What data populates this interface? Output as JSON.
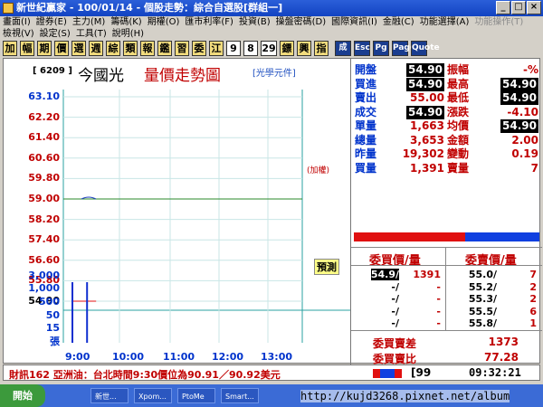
{
  "window": {
    "title": "新世紀贏家 - 100/01/14 - 個股走勢：綜合自選股[群組一]",
    "minimize": "_",
    "maximize": "□",
    "close": "×"
  },
  "menu_row1": [
    "畫面(I)",
    "證券(E)",
    "主力(M)",
    "籌碼(K)",
    "期權(O)",
    "匯市利率(F)",
    "投資(B)",
    "操盤密碼(D)",
    "國際資訊(I)",
    "金融(C)",
    "功能選擇(A)",
    "功能操作(T)"
  ],
  "menu_row2": [
    "檢視(V)",
    "設定(S)",
    "工具(T)",
    "說明(H)"
  ],
  "toolbar": {
    "keys": [
      "加",
      "幅",
      "期",
      "價",
      "選",
      "週",
      "綜",
      "類",
      "報",
      "鑑",
      "習",
      "委",
      "江"
    ],
    "nums": [
      "9",
      "8",
      "29"
    ],
    "more": [
      "鏢",
      "興",
      "指"
    ],
    "icons": [
      "成",
      "Esc",
      "Pg",
      "Page",
      "Quote"
    ]
  },
  "chart_header": {
    "code": "[ 6209 ]",
    "name": "今國光",
    "title": "量價走勢圖",
    "vendor": "[光學元件]"
  },
  "price_axis": [
    "63.10",
    "62.20",
    "61.40",
    "60.60",
    "59.80",
    "59.00",
    "58.20",
    "57.40",
    "56.60",
    "55.80",
    "54.90"
  ],
  "volume_axis": [
    "3,000",
    "1,000",
    "500",
    "50",
    "15",
    "張"
  ],
  "time_axis": [
    "9:00",
    "10:00",
    "11:00",
    "12:00",
    "13:00"
  ],
  "annotations": {
    "ref_note": "(加權)",
    "projection": "預測"
  },
  "chart_data": {
    "type": "line",
    "price_ylim": [
      54.9,
      63.1
    ],
    "reference_price": 59.0,
    "intraday_price": [
      {
        "t": "9:00",
        "p": 54.9
      },
      {
        "t": "9:18",
        "p": 54.9
      }
    ],
    "volume_bars": [
      {
        "t": "9:00",
        "v": 1000
      },
      {
        "t": "9:18",
        "v": 1000
      }
    ],
    "x_ticks": [
      "9:00",
      "10:00",
      "11:00",
      "12:00",
      "13:00"
    ]
  },
  "quotes": [
    {
      "l1": "開盤",
      "v1": "54.90",
      "b1": true,
      "l2": "振幅",
      "v2": "-%",
      "b2": false
    },
    {
      "l1": "買進",
      "v1": "54.90",
      "b1": true,
      "l2": "最高",
      "v2": "54.90",
      "b2": true
    },
    {
      "l1": "賣出",
      "v1": "55.00",
      "b1": false,
      "l2": "最低",
      "v2": "54.90",
      "b2": true
    },
    {
      "l1": "成交",
      "v1": "54.90",
      "b1": true,
      "l2": "漲跌",
      "v2": "-4.10",
      "b2": false
    },
    {
      "l1": "單量",
      "v1": "1,663",
      "b1": false,
      "l2": "均價",
      "v2": "54.90",
      "b2": true
    },
    {
      "l1": "總量",
      "v1": "3,653",
      "b1": false,
      "l2": "金額",
      "v2": "2.00",
      "b2": false
    },
    {
      "l1": "昨量",
      "v1": "19,302",
      "b1": false,
      "l2": "變動",
      "v2": "0.19",
      "b2": false
    },
    {
      "l1": "買量",
      "v1": "1,391",
      "b1": false,
      "l2": "賣量",
      "v2": "7",
      "b2": false
    }
  ],
  "buy_sell_ratio": 0.6,
  "order_book": {
    "bid_header": "委買價/量",
    "ask_header": "委賣價/量",
    "rows": [
      {
        "bid_p": "54.9",
        "bid_v": "1391",
        "ask_p": "55.0",
        "ask_v": "7"
      },
      {
        "bid_p": "-",
        "bid_v": "-",
        "ask_p": "55.2",
        "ask_v": "2"
      },
      {
        "bid_p": "-",
        "bid_v": "-",
        "ask_p": "55.3",
        "ask_v": "2"
      },
      {
        "bid_p": "-",
        "bid_v": "-",
        "ask_p": "55.5",
        "ask_v": "6"
      },
      {
        "bid_p": "-",
        "bid_v": "-",
        "ask_p": "55.8",
        "ask_v": "1"
      }
    ],
    "diff_label": "委買賣差",
    "diff_value": "1373",
    "ratio_label": "委買賣比",
    "ratio_value": "77.28"
  },
  "status": {
    "news": "財訊162 亞洲油：台北時間9:30價位為90.91／90.92美元",
    "page": "[99",
    "time": "09:32:21"
  },
  "taskbar": {
    "start": "開始",
    "tasks": [
      "新世...",
      "Xpom...",
      "PtoMe",
      "Smart..."
    ],
    "watermark": "http://kujd3268.pixnet.net/album"
  }
}
